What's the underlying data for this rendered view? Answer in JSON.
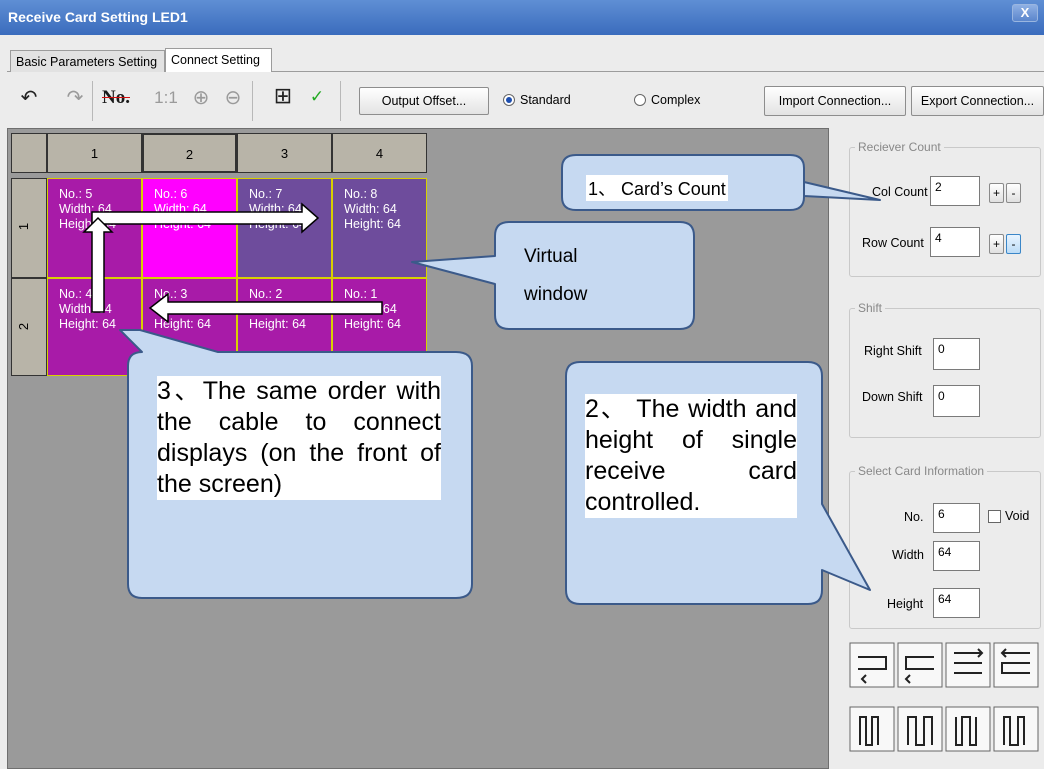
{
  "window": {
    "title": "Receive Card Setting LED1",
    "close_label": "X"
  },
  "tabs": [
    {
      "label": "Basic Parameters Setting"
    },
    {
      "label": "Connect Setting"
    }
  ],
  "toolbar": {
    "undo_glyph": "↶",
    "redo_glyph": "↷",
    "number_label": "No.",
    "ratio_label": "1:1",
    "zoom_in_glyph": "⊕",
    "zoom_out_glyph": "⊖",
    "grid_glyph": "⊞",
    "check_glyph": "✓",
    "output_offset_label": "Output Offset...",
    "standard_label": "Standard",
    "complex_label": "Complex",
    "selected_mode": "Standard",
    "import_label": "Import Connection...",
    "export_label": "Export Connection..."
  },
  "grid": {
    "col_headers": [
      "1",
      "2",
      "3",
      "4"
    ],
    "row_headers": [
      "1",
      "2"
    ],
    "rows": [
      [
        {
          "no": "No.: 5",
          "width": "Width: 64",
          "height": "Height: 64",
          "color": "#a81ba8"
        },
        {
          "no": "No.: 6",
          "width": "Width: 64",
          "height": "Height: 64",
          "color": "#ff00ff"
        },
        {
          "no": "No.: 7",
          "width": "Width: 64",
          "height": "Height: 64",
          "color": "#6e4c9c"
        },
        {
          "no": "No.: 8",
          "width": "Width: 64",
          "height": "Height: 64",
          "color": "#6e4c9c"
        }
      ],
      [
        {
          "no": "No.: 4",
          "width": "Width: 64",
          "height": "Height: 64",
          "color": "#a81ba8"
        },
        {
          "no": "No.: 3",
          "width": "Width: 64",
          "height": "Height: 64",
          "color": "#a81ba8"
        },
        {
          "no": "No.: 2",
          "width": "Width: 64",
          "height": "Height: 64",
          "color": "#a81ba8"
        },
        {
          "no": "No.: 1",
          "width": "Width: 64",
          "height": "Height: 64",
          "color": "#a81ba8"
        }
      ]
    ]
  },
  "receiver_count": {
    "title": "Reciever Count",
    "col_label": "Col Count",
    "col_value": "2",
    "row_label": "Row Count",
    "row_value": "4",
    "plus": "+",
    "minus": "-"
  },
  "shift": {
    "title": "Shift",
    "right_label": "Right Shift",
    "right_value": "0",
    "down_label": "Down Shift",
    "down_value": "0"
  },
  "select_card": {
    "title": "Select Card Information",
    "no_label": "No.",
    "no_value": "6",
    "void_label": "Void",
    "width_label": "Width",
    "width_value": "64",
    "height_label": "Height",
    "height_value": "64"
  },
  "callouts": {
    "card_count": "1、 Card’s Count",
    "virtual_window": "Virtual window",
    "same_order": "3、The same order with the cable to connect displays (on the front of the screen)",
    "width_height": "2、 The width and height of single receive card controlled."
  },
  "colors": {
    "title_bar": "#3a6cbd",
    "callout_fill": "#c6d9f1",
    "callout_border": "#3b5a8a",
    "canvas": "#9a9a9a"
  }
}
